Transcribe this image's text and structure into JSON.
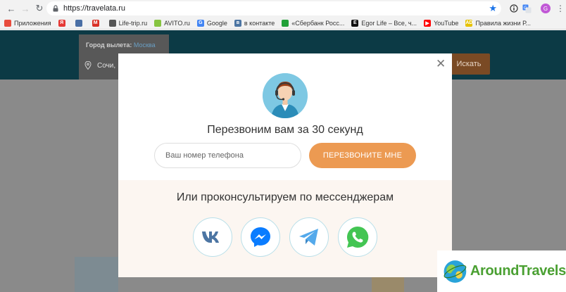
{
  "browser": {
    "url": "https://travelata.ru",
    "profile_initial": "G",
    "bookmarks": [
      {
        "label": "Приложения",
        "color": "#e84c3d",
        "glyph": ""
      },
      {
        "label": "",
        "color": "#e53935",
        "glyph": "Я"
      },
      {
        "label": "",
        "color": "#4a6fa5",
        "glyph": ""
      },
      {
        "label": "",
        "color": "#d93025",
        "glyph": "M"
      },
      {
        "label": "Life-trip.ru",
        "color": "#555555",
        "glyph": ""
      },
      {
        "label": "AVITO.ru",
        "color": "#86c440",
        "glyph": ""
      },
      {
        "label": "Google",
        "color": "#4285f4",
        "glyph": "G"
      },
      {
        "label": "в контакте",
        "color": "#4c75a3",
        "glyph": "в"
      },
      {
        "label": "«Сбербанк Росс...",
        "color": "#21a038",
        "glyph": ""
      },
      {
        "label": "Egor Life – Все, ч...",
        "color": "#111111",
        "glyph": "E"
      },
      {
        "label": "YouTube",
        "color": "#ff0000",
        "glyph": "▶"
      },
      {
        "label": "Правила жизни Р...",
        "color": "#e6c200",
        "glyph": "AD"
      }
    ]
  },
  "site": {
    "departure_label": "Город вылета:",
    "departure_city": "Москва",
    "origin_value": "Сочи,",
    "search_button": "Искать"
  },
  "modal": {
    "title": "Перезвоним вам за 30 секунд",
    "phone_placeholder": "Ваш номер телефона",
    "callback_button": "ПЕРЕЗВОНИТЕ МНЕ",
    "messengers_title": "Или проконсультируем по мессенджерам",
    "messengers": [
      {
        "name": "vk",
        "color": "#4c75a3"
      },
      {
        "name": "messenger",
        "color": "#0a7cff"
      },
      {
        "name": "telegram",
        "color": "#54a9eb"
      },
      {
        "name": "whatsapp",
        "color": "#43c553"
      }
    ]
  },
  "watermark": {
    "text": "AroundTravels"
  },
  "colors": {
    "accent": "#ec9a52",
    "header": "#0c3a45",
    "messenger_border": "#b9dfe9"
  }
}
